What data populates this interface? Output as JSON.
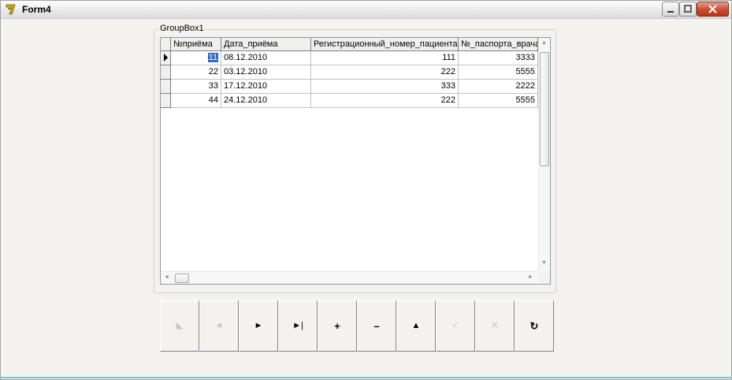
{
  "window": {
    "title": "Form4"
  },
  "groupbox": {
    "caption": "GroupBox1"
  },
  "grid": {
    "columns": [
      "№приёма",
      "Дата_приёма",
      "Регистрационный_номер_пациента",
      "№_паспорта_врача"
    ],
    "rows": [
      [
        "11",
        "08.12.2010",
        "111",
        "3333"
      ],
      [
        "22",
        "03.12.2010",
        "222",
        "5555"
      ],
      [
        "33",
        "17.12.2010",
        "333",
        "2222"
      ],
      [
        "44",
        "24.12.2010",
        "222",
        "5555"
      ]
    ],
    "selected_row": 0
  },
  "navigator": {
    "buttons": [
      {
        "name": "first",
        "glyph": "◣",
        "enabled": false
      },
      {
        "name": "prior",
        "glyph": "◄",
        "enabled": false
      },
      {
        "name": "next",
        "glyph": "►",
        "enabled": true
      },
      {
        "name": "last",
        "glyph": "►|",
        "enabled": true
      },
      {
        "name": "insert",
        "glyph": "+",
        "enabled": true
      },
      {
        "name": "delete",
        "glyph": "–",
        "enabled": true
      },
      {
        "name": "edit",
        "glyph": "▲",
        "enabled": true
      },
      {
        "name": "post",
        "glyph": "✓",
        "enabled": false
      },
      {
        "name": "cancel",
        "glyph": "✕",
        "enabled": false
      },
      {
        "name": "refresh",
        "glyph": "↻",
        "enabled": true
      }
    ]
  },
  "colors": {
    "selection": "#316ac5",
    "accent_line": "#78c5d8"
  }
}
